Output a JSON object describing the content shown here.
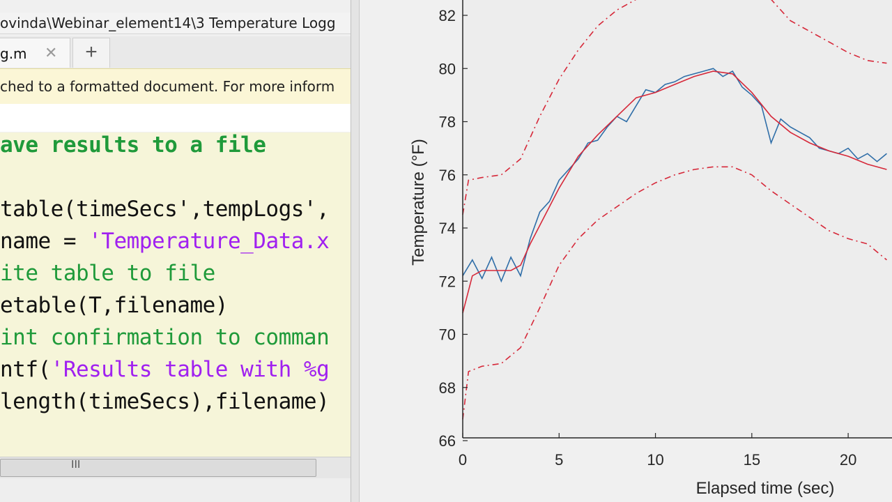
{
  "editor": {
    "path": "ovinda\\Webinar_element14\\3 Temperature Logg",
    "tab_label": "g.m",
    "tab_close": "✕",
    "new_tab": "+",
    "notice": "ched to a formatted document. For more inform",
    "scroll_grip": "III",
    "code_lines": [
      {
        "segments": [
          {
            "cls": "cmb",
            "text": "ave results to a file"
          }
        ]
      },
      {
        "segments": []
      },
      {
        "segments": [
          {
            "cls": "",
            "text": "table(timeSecs',tempLogs',"
          }
        ]
      },
      {
        "segments": [
          {
            "cls": "",
            "text": "name = "
          },
          {
            "cls": "str",
            "text": "'Temperature_Data.x"
          }
        ]
      },
      {
        "segments": [
          {
            "cls": "cm",
            "text": "ite table to file"
          }
        ]
      },
      {
        "segments": [
          {
            "cls": "",
            "text": "etable(T,filename)"
          }
        ]
      },
      {
        "segments": [
          {
            "cls": "cm",
            "text": "int confirmation to comman"
          }
        ]
      },
      {
        "segments": [
          {
            "cls": "",
            "text": "ntf("
          },
          {
            "cls": "str",
            "text": "'Results table with %g"
          }
        ]
      },
      {
        "segments": [
          {
            "cls": "",
            "text": "length(timeSecs),filename)"
          }
        ]
      }
    ]
  },
  "chart_data": {
    "type": "line",
    "xlabel": "Elapsed time (sec)",
    "ylabel": "Temperature (°F)",
    "xlim": [
      0,
      22
    ],
    "ylim": [
      66,
      82.6
    ],
    "xticks": [
      0,
      5,
      10,
      15,
      20
    ],
    "yticks": [
      66,
      68,
      70,
      72,
      74,
      76,
      78,
      80,
      82
    ],
    "colors": {
      "raw": "#2f6ea8",
      "fit": "#d62839",
      "bounds": "#d62839"
    },
    "series": [
      {
        "style": "solid-blue-raw",
        "x": [
          0,
          0.5,
          1.0,
          1.5,
          2.0,
          2.5,
          3.0,
          3.5,
          4.0,
          4.5,
          5.0,
          5.5,
          6.0,
          6.5,
          7.0,
          7.5,
          8.0,
          8.5,
          9.0,
          9.5,
          10.0,
          10.5,
          11.0,
          11.5,
          12.0,
          12.5,
          13.0,
          13.5,
          14.0,
          14.5,
          15.0,
          15.5,
          16.0,
          16.5,
          17.0,
          17.5,
          18.0,
          18.5,
          19.0,
          19.5,
          20.0,
          20.5,
          21.0,
          21.5,
          22.0
        ],
        "y": [
          72.2,
          72.8,
          72.1,
          72.9,
          72.0,
          72.9,
          72.2,
          73.6,
          74.6,
          75.0,
          75.8,
          76.2,
          76.6,
          77.2,
          77.3,
          77.8,
          78.2,
          78.0,
          78.6,
          79.2,
          79.1,
          79.4,
          79.5,
          79.7,
          79.8,
          79.9,
          80.0,
          79.7,
          79.9,
          79.3,
          79.0,
          78.6,
          77.2,
          78.1,
          77.8,
          77.6,
          77.4,
          77.0,
          76.9,
          76.8,
          77.0,
          76.6,
          76.8,
          76.5,
          76.8
        ]
      },
      {
        "style": "solid-red-fit",
        "x": [
          0,
          0.5,
          1.0,
          1.5,
          2.0,
          2.5,
          3.0,
          3.5,
          4.0,
          5.0,
          6.0,
          7.0,
          8.0,
          9.0,
          10.0,
          11.0,
          12.0,
          13.0,
          14.0,
          15.0,
          16.0,
          17.0,
          18.0,
          19.0,
          20.0,
          21.0,
          22.0
        ],
        "y": [
          70.8,
          72.2,
          72.4,
          72.4,
          72.4,
          72.4,
          72.6,
          73.4,
          74.1,
          75.5,
          76.7,
          77.5,
          78.2,
          78.9,
          79.1,
          79.4,
          79.7,
          79.9,
          79.8,
          79.1,
          78.2,
          77.6,
          77.2,
          76.9,
          76.7,
          76.4,
          76.2
        ]
      },
      {
        "style": "dashed-red-upper",
        "x": [
          0,
          0.3,
          1.0,
          2.0,
          3.0,
          4.0,
          5.0,
          6.0,
          7.0,
          8.0,
          9.0,
          10.0,
          11.0,
          12.0,
          13.0,
          14.0,
          15.0,
          16.0,
          17.0,
          18.0,
          19.0,
          20.0,
          21.0,
          22.0
        ],
        "y": [
          74.5,
          75.8,
          75.9,
          76.0,
          76.6,
          78.2,
          79.6,
          80.7,
          81.6,
          82.2,
          82.6,
          83.0,
          83.3,
          83.5,
          83.5,
          83.4,
          83.1,
          82.6,
          81.8,
          81.4,
          81.0,
          80.6,
          80.3,
          80.2
        ]
      },
      {
        "style": "dashed-red-lower",
        "x": [
          0,
          0.3,
          1.0,
          2.0,
          3.0,
          4.0,
          5.0,
          6.0,
          7.0,
          8.0,
          9.0,
          10.0,
          11.0,
          12.0,
          13.0,
          14.0,
          15.0,
          16.0,
          17.0,
          18.0,
          19.0,
          20.0,
          21.0,
          22.0
        ],
        "y": [
          66.8,
          68.6,
          68.8,
          68.9,
          69.5,
          71.0,
          72.6,
          73.6,
          74.3,
          74.8,
          75.3,
          75.7,
          76.0,
          76.2,
          76.3,
          76.3,
          76.0,
          75.4,
          74.9,
          74.4,
          73.9,
          73.6,
          73.4,
          72.8
        ]
      }
    ]
  }
}
